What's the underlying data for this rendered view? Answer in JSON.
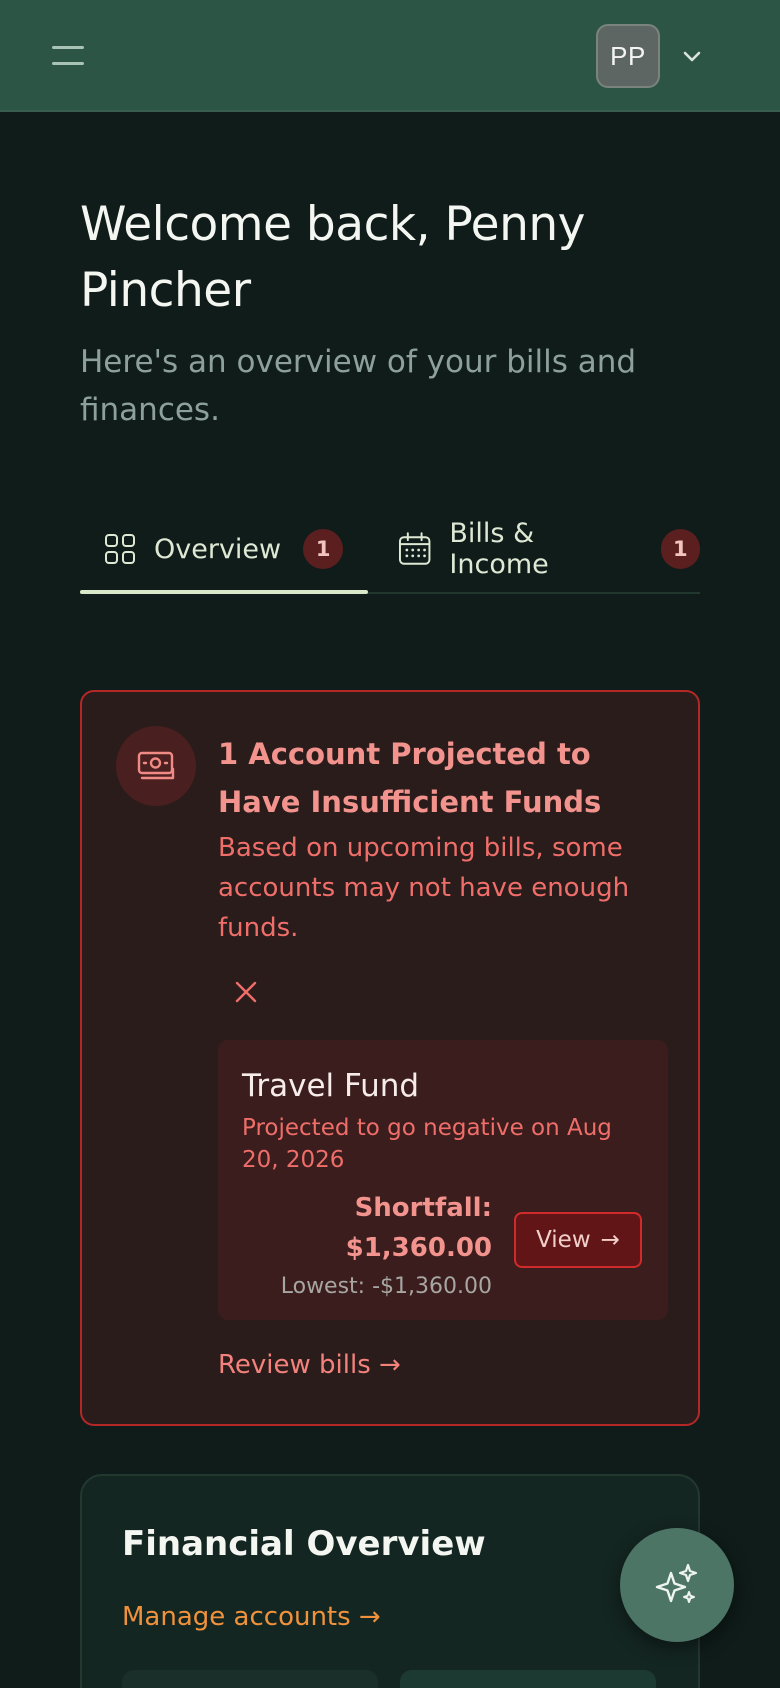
{
  "header": {
    "avatar_initials": "PP",
    "menu_icon": "menu-icon",
    "dropdown_icon": "chevron-down-icon"
  },
  "welcome": {
    "title": "Welcome back, Penny Pincher",
    "subtitle": "Here's an overview of your bills and finances."
  },
  "tabs": [
    {
      "label": "Overview",
      "badge": "1",
      "icon": "grid-icon",
      "active": true
    },
    {
      "label": "Bills & Income",
      "badge": "1",
      "icon": "calendar-icon",
      "active": false
    }
  ],
  "alert": {
    "icon": "cash-icon",
    "title": "1 Account Projected to Have Insufficient Funds",
    "body": "Based on upcoming bills, some accounts may not have enough funds.",
    "account": {
      "name": "Travel Fund",
      "projection": "Projected to go negative on Aug 20, 2026",
      "shortfall_label": "Shortfall:",
      "shortfall_amount": "$1,360.00",
      "lowest": "Lowest: -$1,360.00",
      "view_label": "View",
      "view_arrow": "→"
    },
    "review_link": "Review bills →"
  },
  "financial_overview": {
    "title": "Financial Overview",
    "manage_link": "Manage accounts →"
  },
  "fab_icon": "sparkles-icon",
  "colors": {
    "header_bg": "#2c5545",
    "page_bg": "#0f1c19",
    "alert_border": "#b42727",
    "alert_text": "#ef6e6a",
    "link_orange": "#f0923c",
    "tab_underline": "#d8e8c8"
  }
}
